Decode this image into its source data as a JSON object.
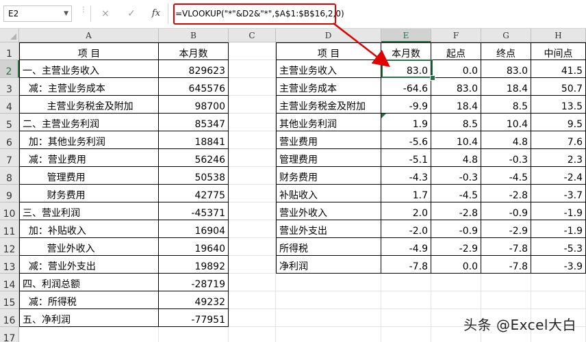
{
  "name_box": "E2",
  "formula_bar": {
    "cancel_icon": "×",
    "enter_icon": "✓",
    "fx_label": "fx",
    "formula": "=VLOOKUP(\"*\"&D2&\"*\",$A$1:$B$16,2,0)"
  },
  "columns": [
    "A",
    "B",
    "C",
    "D",
    "E",
    "F",
    "G",
    "H"
  ],
  "rows": [
    "1",
    "2",
    "3",
    "4",
    "5",
    "6",
    "7",
    "8",
    "9",
    "10",
    "11",
    "12",
    "13",
    "14",
    "15",
    "16",
    "17"
  ],
  "selected_cell": {
    "column": "E",
    "row": "2"
  },
  "table_left": {
    "headers": [
      "项    目",
      "本月数"
    ],
    "rows": [
      {
        "item": "一、主营业务收入",
        "value": "829623"
      },
      {
        "item": "  减：主营业务成本",
        "value": "645576"
      },
      {
        "item": "        主营业务税金及附加",
        "value": "98700"
      },
      {
        "item": "二、主营业务利润",
        "value": "85347"
      },
      {
        "item": "  加：其他业务利润",
        "value": "18841"
      },
      {
        "item": "  减：营业费用",
        "value": "56246"
      },
      {
        "item": "        管理费用",
        "value": "50538"
      },
      {
        "item": "        财务费用",
        "value": "42775"
      },
      {
        "item": "三、营业利润",
        "value": "-45371"
      },
      {
        "item": "  加：补贴收入",
        "value": "16904"
      },
      {
        "item": "        营业外收入",
        "value": "19640"
      },
      {
        "item": "  减：营业外支出",
        "value": "19892"
      },
      {
        "item": "四、利润总额",
        "value": "-28719"
      },
      {
        "item": "  减：所得税",
        "value": "49232"
      },
      {
        "item": "五、净利润",
        "value": "-77951"
      }
    ]
  },
  "table_right": {
    "headers": [
      "项    目",
      "本月数",
      "起点",
      "终点",
      "中间点"
    ],
    "rows": [
      [
        "主营业务收入",
        "83.0",
        "0.0",
        "83.0",
        "41.5"
      ],
      [
        "主营业务成本",
        "-64.6",
        "83.0",
        "18.4",
        "50.7"
      ],
      [
        "主营业务税金及附加",
        "-9.9",
        "18.4",
        "8.5",
        "13.5"
      ],
      [
        "其他业务利润",
        "1.9",
        "8.5",
        "10.4",
        "9.5"
      ],
      [
        "营业费用",
        "-5.6",
        "10.4",
        "4.8",
        "7.6"
      ],
      [
        "管理费用",
        "-5.1",
        "4.8",
        "-0.3",
        "2.3"
      ],
      [
        "财务费用",
        "-4.3",
        "-0.3",
        "-4.5",
        "-2.4"
      ],
      [
        "补贴收入",
        "1.7",
        "-4.5",
        "-2.8",
        "-3.7"
      ],
      [
        "营业外收入",
        "2.0",
        "-2.8",
        "-0.9",
        "-1.9"
      ],
      [
        "营业外支出",
        "-2.0",
        "-0.9",
        "-2.9",
        "-1.9"
      ],
      [
        "所得税",
        "-4.9",
        "-2.9",
        "-7.8",
        "-5.3"
      ],
      [
        "净利润",
        "-7.8",
        "0.0",
        "-7.8",
        "-3.9"
      ]
    ]
  },
  "watermark": "头条 @Excel大白",
  "colors": {
    "accent": "#217346",
    "highlight": "#e00000"
  }
}
